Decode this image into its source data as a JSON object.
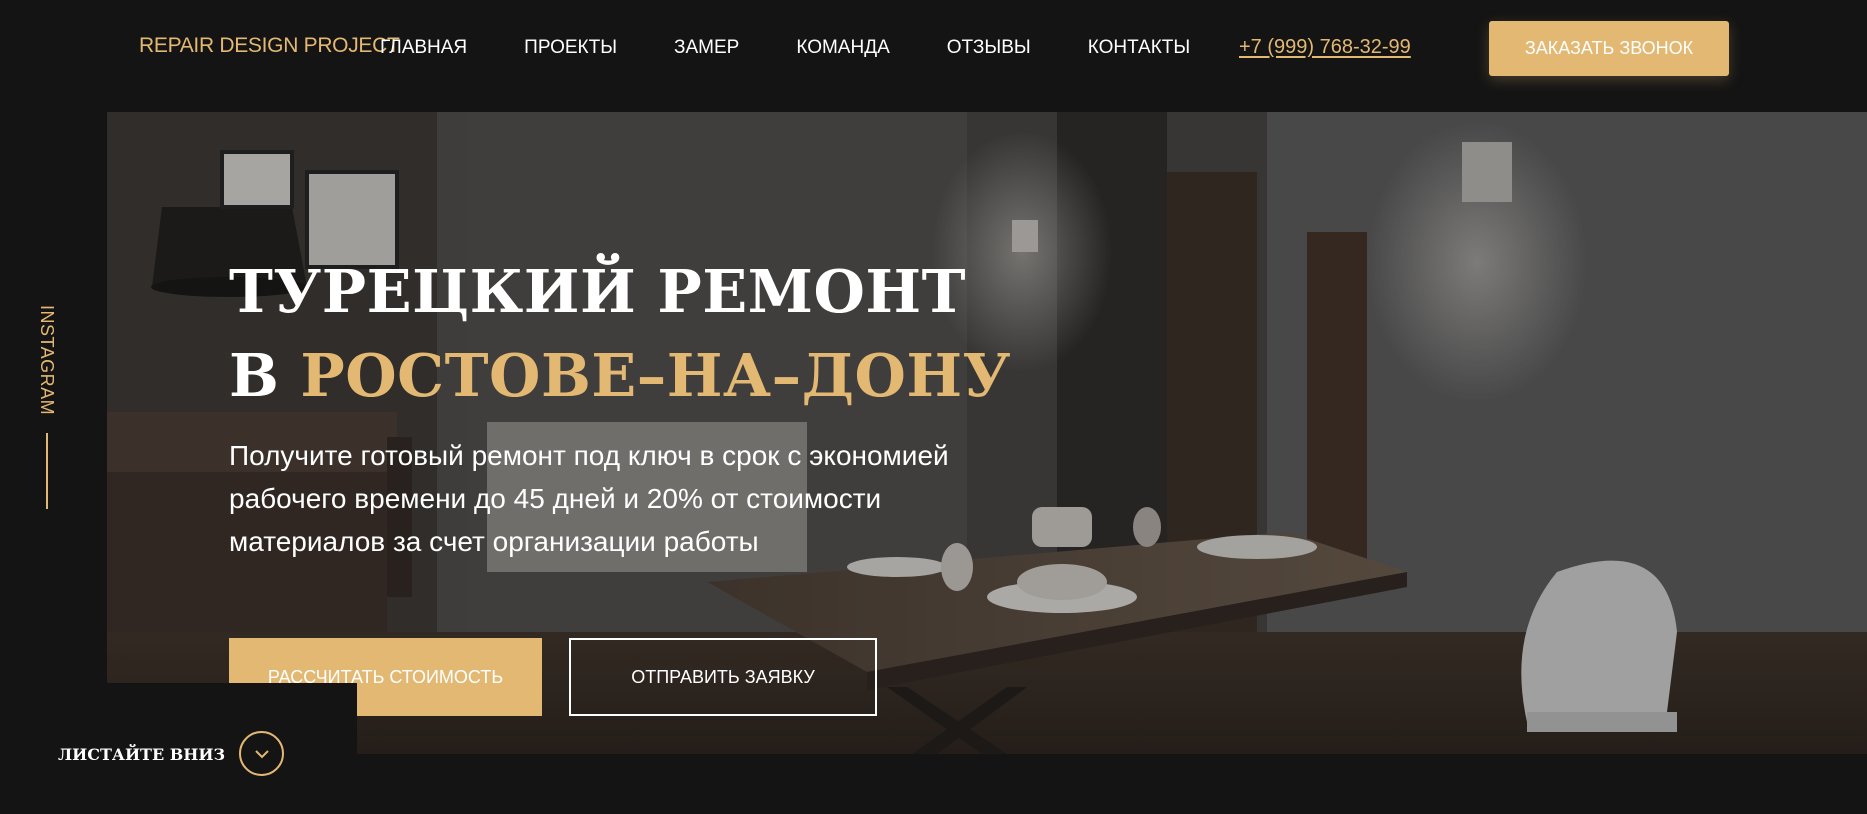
{
  "brand": {
    "logo": "REPAIR DESIGN PROJECT",
    "accent_color": "#e3b872",
    "bg_color": "#141414"
  },
  "nav": {
    "items": [
      {
        "label": "ГЛАВНАЯ"
      },
      {
        "label": "ПРОЕКТЫ"
      },
      {
        "label": "ЗАМЕР"
      },
      {
        "label": "КОМАНДА"
      },
      {
        "label": "ОТЗЫВЫ"
      },
      {
        "label": "КОНТАКТЫ"
      }
    ]
  },
  "header": {
    "phone": "+7 (999) 768-32-99",
    "call_button": "ЗАКАЗАТЬ ЗВОНОК"
  },
  "social": {
    "instagram": "INSTAGRAM"
  },
  "hero": {
    "title_line1": "ТУРЕЦКИЙ РЕМОНТ",
    "title_line2_prefix": "В",
    "title_line2_accent": "РОСТОВЕ–НА–ДОНУ",
    "subtitle_line1": "Получите готовый ремонт под ключ в срок с экономией",
    "subtitle_line2": "рабочего времени до 45 дней и 20% от стоимости",
    "subtitle_line3": "материалов за счет организации работы",
    "primary_button": "РАССЧИТАТЬ СТОИМОСТЬ",
    "secondary_button": "ОТПРАВИТЬ ЗАЯВКУ",
    "background": "interior-photo"
  },
  "scroll": {
    "label": "ЛИСТАЙТЕ ВНИЗ",
    "icon": "chevron-down-icon"
  }
}
